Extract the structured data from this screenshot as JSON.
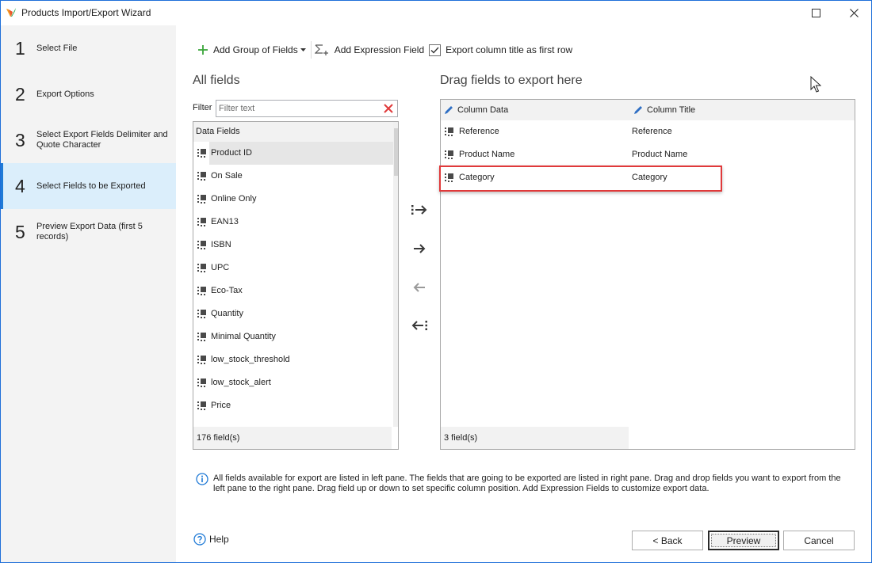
{
  "window": {
    "title": "Products Import/Export Wizard"
  },
  "steps": [
    {
      "number": "1",
      "label": "Select File",
      "active": false
    },
    {
      "number": "2",
      "label": "Export Options",
      "active": false
    },
    {
      "number": "3",
      "label": "Select Export Fields Delimiter and Quote Character",
      "active": false
    },
    {
      "number": "4",
      "label": "Select Fields to be Exported",
      "active": true
    },
    {
      "number": "5",
      "label": "Preview Export Data (first 5 records)",
      "active": false
    }
  ],
  "toolbar": {
    "add_group_label": "Add Group of Fields",
    "add_expression_label": "Add Expression Field",
    "export_title_label": "Export column title as first row",
    "export_title_checked": true
  },
  "all_fields": {
    "heading": "All fields",
    "filter_label": "Filter",
    "filter_placeholder": "Filter text",
    "group_header": "Data Fields",
    "items": [
      "Product ID",
      "On Sale",
      "Online Only",
      "EAN13",
      "ISBN",
      "UPC",
      "Eco-Tax",
      "Quantity",
      "Minimal Quantity",
      "low_stock_threshold",
      "low_stock_alert",
      "Price"
    ],
    "selected_index": 0,
    "count": "176 field(s)"
  },
  "export_fields": {
    "heading": "Drag fields to export here",
    "col_data_header": "Column Data",
    "col_title_header": "Column Title",
    "rows": [
      {
        "data": "Reference",
        "title": "Reference"
      },
      {
        "data": "Product Name",
        "title": "Product Name"
      },
      {
        "data": "Category",
        "title": "Category"
      }
    ],
    "highlighted_index": 2,
    "count": "3 field(s)"
  },
  "info_text": "All fields available for export are listed in left pane. The fields that are going to be exported are listed in right pane. Drag and drop fields you want to export from the left pane to the right pane. Drag field up or down to set specific column position. Add Expression Fields to customize export data.",
  "buttons": {
    "help": "Help",
    "back": "< Back",
    "preview": "Preview",
    "cancel": "Cancel"
  },
  "colors": {
    "accent": "#1f7ad6",
    "active_step_bg": "#dbeefb",
    "highlight": "#e0393a",
    "add_green": "#3aa63a"
  }
}
